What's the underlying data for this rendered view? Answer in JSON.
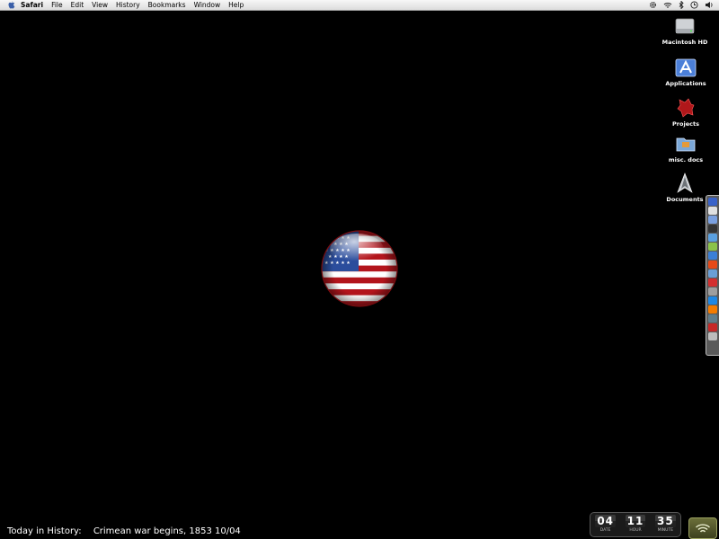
{
  "menubar": {
    "apple_icon": "apple-icon",
    "app_name": "Safari",
    "items": [
      "File",
      "Edit",
      "View",
      "History",
      "Bookmarks",
      "Window",
      "Help"
    ],
    "status_icons": [
      "gear-icon",
      "wifi-icon",
      "volume-icon",
      "bluetooth-icon",
      "clock-icon",
      "sound-icon"
    ]
  },
  "desktop": {
    "icons": [
      {
        "label": "Macintosh HD",
        "icon": "hard-drive-icon"
      },
      {
        "label": "Applications",
        "icon": "applications-folder-icon"
      },
      {
        "label": "Projects",
        "icon": "projects-folder-icon"
      },
      {
        "label": "misc. docs",
        "icon": "folder-icon"
      },
      {
        "label": "Documents",
        "icon": "documents-icon"
      }
    ],
    "center_image": "us-flag-globe-icon"
  },
  "dock": {
    "colors": [
      "#3a63c9",
      "#e0e0e0",
      "#7aa0e0",
      "#333333",
      "#5aa0e0",
      "#8bc34a",
      "#3b7fd6",
      "#e64a19",
      "#6a9fd6",
      "#d32f2f",
      "#9e9e9e",
      "#1e88e5",
      "#f57c00",
      "#607d8b",
      "#c62828",
      "#bdbdbd"
    ]
  },
  "ticker": {
    "label": "Today in History:",
    "text": "Crimean war begins, 1853 10/04"
  },
  "clock": {
    "date": "04",
    "hour": "11",
    "minute": "35",
    "date_label": "DATE",
    "hour_label": "HOUR",
    "minute_label": "MINUTE"
  }
}
